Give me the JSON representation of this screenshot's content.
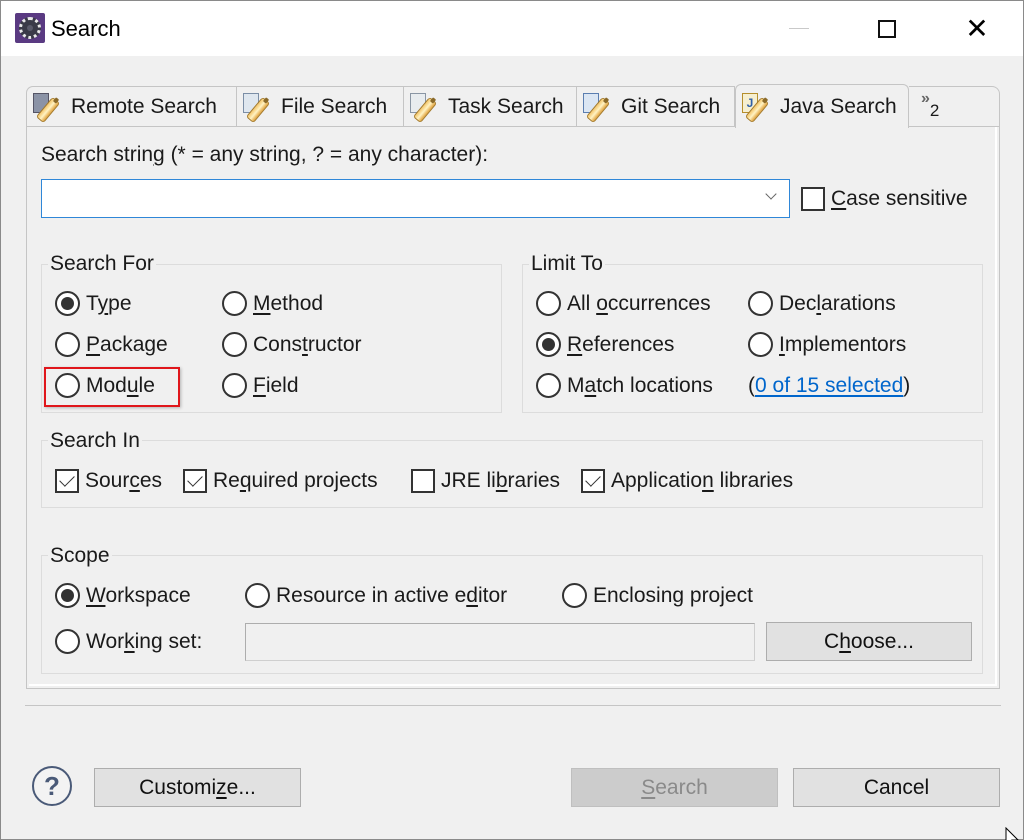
{
  "window": {
    "title": "Search",
    "controls": {
      "minimize": "—",
      "maximize": "☐",
      "close": "✕"
    }
  },
  "tabs": [
    {
      "label": "Remote Search",
      "icon": "remote-search-icon",
      "active": false
    },
    {
      "label": "File Search",
      "icon": "file-search-icon",
      "active": false
    },
    {
      "label": "Task Search",
      "icon": "task-search-icon",
      "active": false
    },
    {
      "label": "Git Search",
      "icon": "git-search-icon",
      "active": false
    },
    {
      "label": "Java Search",
      "icon": "java-search-icon",
      "active": true
    }
  ],
  "tab_overflow": {
    "chevron": "»",
    "count": "2"
  },
  "search_string": {
    "label_pre": "Search strin",
    "label_mn": "g",
    "label_post": " (* = any string, ? = any character):",
    "value": "",
    "placeholder": ""
  },
  "case_sensitive": {
    "mn": "C",
    "rest": "ase sensitive",
    "checked": false
  },
  "search_for": {
    "title": "Search For",
    "options": [
      {
        "pre": "T",
        "mn": "y",
        "post": "pe",
        "checked": true
      },
      {
        "pre": "",
        "mn": "M",
        "post": "ethod",
        "checked": false
      },
      {
        "pre": "",
        "mn": "P",
        "post": "ackage",
        "checked": false
      },
      {
        "pre": "Cons",
        "mn": "t",
        "post": "ructor",
        "checked": false
      },
      {
        "pre": "Mod",
        "mn": "u",
        "post": "le",
        "checked": false,
        "highlighted": true
      },
      {
        "pre": "",
        "mn": "F",
        "post": "ield",
        "checked": false
      }
    ]
  },
  "limit_to": {
    "title": "Limit To",
    "options": [
      {
        "pre": "All ",
        "mn": "o",
        "post": "ccurrences",
        "checked": false
      },
      {
        "pre": "Dec",
        "mn": "l",
        "post": "arations",
        "checked": false
      },
      {
        "pre": "",
        "mn": "R",
        "post": "eferences",
        "checked": true
      },
      {
        "pre": "",
        "mn": "I",
        "post": "mplementors",
        "checked": false
      },
      {
        "pre": "M",
        "mn": "a",
        "post": "tch locations",
        "checked": false
      }
    ],
    "match_link": "0 of 15 selected",
    "paren_open": "(",
    "paren_close": ")"
  },
  "search_in": {
    "title": "Search In",
    "options": [
      {
        "pre": "Sour",
        "mn": "c",
        "post": "es",
        "checked": true
      },
      {
        "pre": "Re",
        "mn": "q",
        "post": "uired projects",
        "checked": true
      },
      {
        "pre": "JRE li",
        "mn": "b",
        "post": "raries",
        "checked": false
      },
      {
        "pre": "Applicatio",
        "mn": "n",
        "post": " libraries",
        "checked": true
      }
    ]
  },
  "scope": {
    "title": "Scope",
    "options": [
      {
        "pre": "",
        "mn": "W",
        "post": "orkspace",
        "checked": true
      },
      {
        "pre": "Resource in active e",
        "mn": "d",
        "post": "itor",
        "checked": false
      },
      {
        "pre": "Enclosing project",
        "mn": "",
        "post": "",
        "checked": false
      },
      {
        "pre": "Wor",
        "mn": "k",
        "post": "ing set:",
        "checked": false
      }
    ],
    "working_set_value": "",
    "choose_button": {
      "pre": "C",
      "mn": "h",
      "post": "oose..."
    }
  },
  "footer": {
    "help_icon": "?",
    "customize_button": {
      "pre": "Customi",
      "mn": "z",
      "post": "e..."
    },
    "search_button": {
      "pre": "",
      "mn": "S",
      "post": "earch",
      "enabled": false
    },
    "cancel_button": "Cancel"
  },
  "colors": {
    "link": "#0066cc",
    "highlight_box": "#e0161b",
    "focus_border": "#2f87d8"
  }
}
